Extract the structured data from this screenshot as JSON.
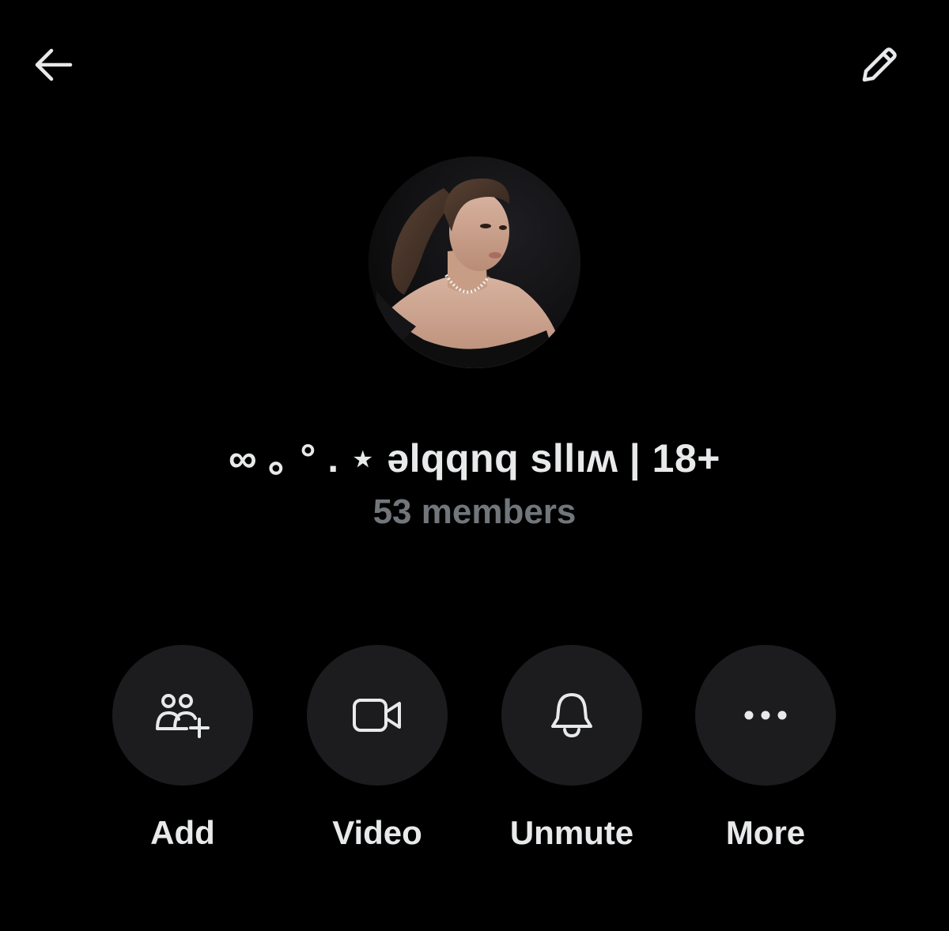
{
  "header": {
    "back_icon": "arrow-left-icon",
    "edit_icon": "pencil-icon"
  },
  "group": {
    "name": "∞ ｡ ° . ⋆ ǝlqqnq sllıʍ | 18+",
    "members": "53 members"
  },
  "actions": [
    {
      "label": "Add",
      "icon": "add-people-icon"
    },
    {
      "label": "Video",
      "icon": "video-camera-icon"
    },
    {
      "label": "Unmute",
      "icon": "bell-icon"
    },
    {
      "label": "More",
      "icon": "more-dots-icon"
    }
  ],
  "colors": {
    "background": "#000000",
    "text_primary": "#e7e9ea",
    "text_secondary": "#71767b",
    "action_circle": "#1c1c1f"
  }
}
